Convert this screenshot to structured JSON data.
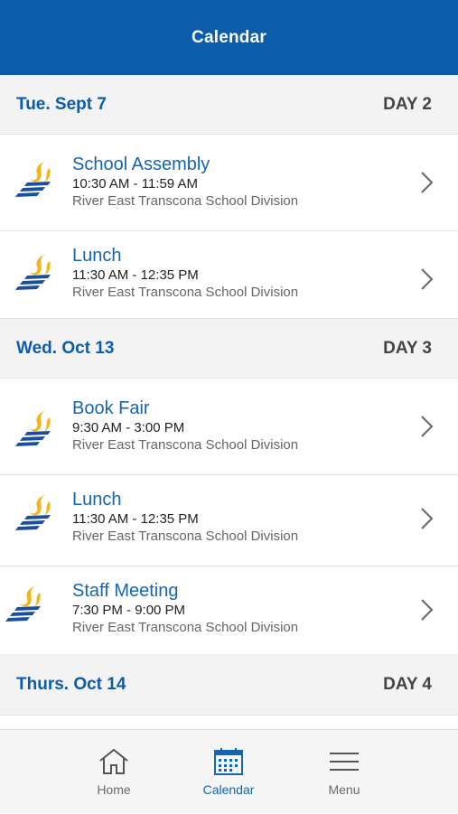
{
  "header": {
    "title": "Calendar"
  },
  "days": [
    {
      "date": "Tue. Sept 7",
      "day": "DAY 2",
      "events": [
        {
          "title": "School Assembly",
          "time": "10:30 AM - 11:59 AM",
          "org": "River East Transcona School Division"
        },
        {
          "title": "Lunch",
          "time": "11:30 AM - 12:35 PM",
          "org": "River East Transcona School Division"
        }
      ]
    },
    {
      "date": "Wed. Oct 13",
      "day": "DAY 3",
      "events": [
        {
          "title": "Book Fair",
          "time": "9:30 AM - 3:00 PM",
          "org": "River East Transcona School Division"
        },
        {
          "title": "Lunch",
          "time": "11:30 AM - 12:35 PM",
          "org": "River East Transcona School Division"
        },
        {
          "title": "Staff Meeting",
          "time": "7:30 PM - 9:00 PM",
          "org": "River East Transcona School Division"
        }
      ]
    },
    {
      "date": "Thurs. Oct 14",
      "day": "DAY 4",
      "events": []
    }
  ],
  "tabs": {
    "home": {
      "label": "Home",
      "icon": "home-icon"
    },
    "calendar": {
      "label": "Calendar",
      "icon": "calendar-icon"
    },
    "menu": {
      "label": "Menu",
      "icon": "hamburger-menu-icon"
    }
  },
  "colors": {
    "brand_blue": "#0b5cab",
    "link_blue": "#1565b0",
    "logo_gold": "#f2b51c",
    "logo_blue": "#1b4f9c"
  }
}
